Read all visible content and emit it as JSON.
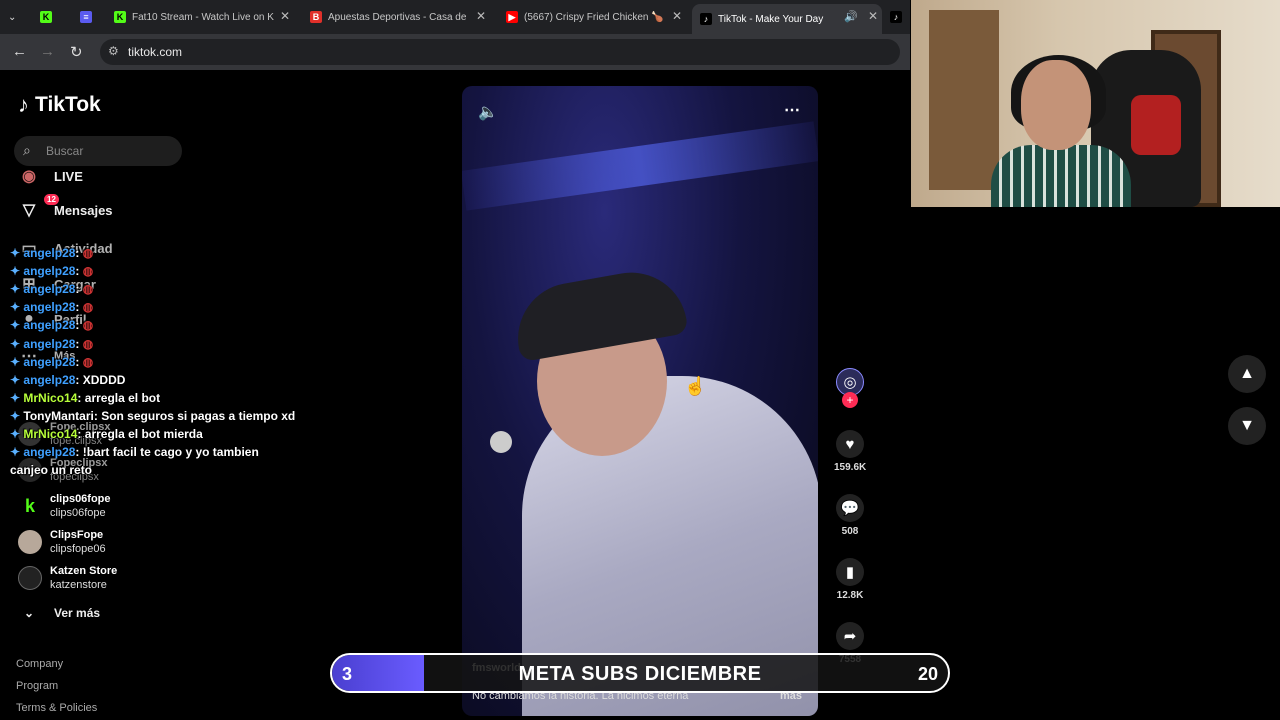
{
  "browser": {
    "tabs": [
      {
        "label": "",
        "icon": "chevron-down-icon"
      },
      {
        "label": "",
        "icon": "kick-icon"
      },
      {
        "label": "",
        "icon": "streamlabs-icon"
      },
      {
        "label": "Fat10 Stream - Watch Live on K",
        "icon": "kick-icon"
      },
      {
        "label": "Apuestas Deportivas - Casa de",
        "icon": "betting-icon"
      },
      {
        "label": "(5667) Crispy Fried Chicken 🍗",
        "icon": "youtube-icon"
      },
      {
        "label": "TikTok - Make Your Day",
        "icon": "tiktok-icon"
      }
    ],
    "url": "tiktok.com"
  },
  "tiktok": {
    "brand": "TikTok",
    "search_placeholder": "Buscar",
    "nav": {
      "live": "LIVE",
      "messages": "Mensajes",
      "messages_badge": "12",
      "activity": "Actividad",
      "upload": "Cargar",
      "profile": "Perfil",
      "more": "Más"
    },
    "accounts": [
      {
        "name": "Fope.clipsx",
        "handle": "fope.clipsx"
      },
      {
        "name": "Fopeclipsx",
        "handle": "fopeclipsx"
      },
      {
        "name": "clips06fope",
        "handle": "clips06fope"
      },
      {
        "name": "ClipsFope",
        "handle": "clipsfope06"
      },
      {
        "name": "Katzen Store",
        "handle": "katzenstore"
      }
    ],
    "see_more": "Ver más",
    "footer": [
      "Company",
      "Program",
      "Terms & Policies"
    ],
    "video": {
      "author": "fmsworld",
      "caption": "No cambiamos la historia. La hicimos eterna",
      "more": "más",
      "likes": "159.6K",
      "comments": "508",
      "saves": "12.8K",
      "shares": "7558"
    }
  },
  "chat": [
    {
      "user": "angelp28",
      "msg": "",
      "color": "#3fa0ff"
    },
    {
      "user": "angelp28",
      "msg": "",
      "color": "#3fa0ff"
    },
    {
      "user": "angelp28",
      "msg": "",
      "color": "#3fa0ff"
    },
    {
      "user": "angelp28",
      "msg": "",
      "color": "#3fa0ff"
    },
    {
      "user": "angelp28",
      "msg": "",
      "color": "#3fa0ff"
    },
    {
      "user": "angelp28",
      "msg": "",
      "color": "#3fa0ff"
    },
    {
      "user": "angelp28",
      "msg": "",
      "color": "#3fa0ff"
    },
    {
      "user": "angelp28",
      "msg": "XDDDD",
      "color": "#3fa0ff"
    },
    {
      "user": "MrNico14",
      "msg": "arregla el bot",
      "color": "#b8ff3a"
    },
    {
      "user": "TonyMantari",
      "msg": "Son seguros si pagas a tiempo xd",
      "color": "#ffffff"
    },
    {
      "user": "MrNico14",
      "msg": "arregla el bot mierda",
      "color": "#b8ff3a"
    },
    {
      "user": "angelp28",
      "msg": "!bart facil te cago y yo tambien",
      "color": "#3fa0ff"
    },
    {
      "user": "",
      "msg": "canjeo un reto",
      "color": "#ffffff"
    }
  ],
  "goal": {
    "title": "META SUBS DICIEMBRE",
    "current": "3",
    "target": "20",
    "progress": 0.15
  }
}
